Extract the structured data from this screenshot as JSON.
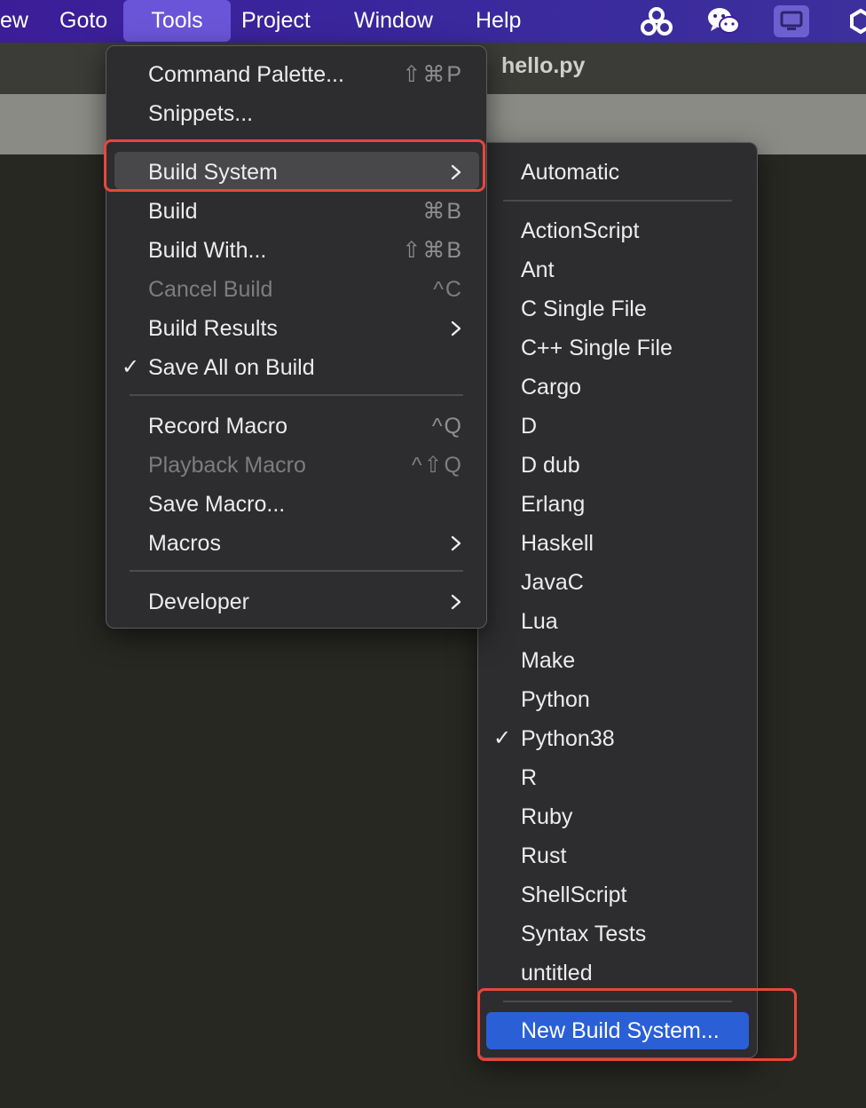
{
  "menubar": {
    "items": [
      {
        "label": "ew"
      },
      {
        "label": "Goto"
      },
      {
        "label": "Tools"
      },
      {
        "label": "Project"
      },
      {
        "label": "Window"
      },
      {
        "label": "Help"
      }
    ],
    "active": "Tools",
    "status_icons": [
      "baidu-netdisk-icon",
      "wechat-icon",
      "screen-share-icon",
      "app-icon"
    ]
  },
  "tab": {
    "title": "hello.py"
  },
  "tools_menu": {
    "items": [
      {
        "label": "Command Palette...",
        "shortcut": "⇧⌘P"
      },
      {
        "label": "Snippets..."
      },
      {
        "label": "Build System"
      },
      {
        "label": "Build",
        "shortcut": "⌘B"
      },
      {
        "label": "Build With...",
        "shortcut": "⇧⌘B"
      },
      {
        "label": "Cancel Build",
        "shortcut": "^C",
        "disabled": true
      },
      {
        "label": "Build Results"
      },
      {
        "label": "Save All on Build",
        "checked": true
      },
      {
        "label": "Record Macro",
        "shortcut": "^Q"
      },
      {
        "label": "Playback Macro",
        "shortcut": "^⇧Q",
        "disabled": true
      },
      {
        "label": "Save Macro..."
      },
      {
        "label": "Macros"
      },
      {
        "label": "Developer"
      }
    ],
    "check_glyph": "✓"
  },
  "build_system_menu": {
    "items": [
      {
        "label": "Automatic"
      },
      {
        "label": "ActionScript"
      },
      {
        "label": "Ant"
      },
      {
        "label": "C Single File"
      },
      {
        "label": "C++ Single File"
      },
      {
        "label": "Cargo"
      },
      {
        "label": "D"
      },
      {
        "label": "D dub"
      },
      {
        "label": "Erlang"
      },
      {
        "label": "Haskell"
      },
      {
        "label": "JavaC"
      },
      {
        "label": "Lua"
      },
      {
        "label": "Make"
      },
      {
        "label": "Python"
      },
      {
        "label": "Python38",
        "checked": true
      },
      {
        "label": "R"
      },
      {
        "label": "Ruby"
      },
      {
        "label": "Rust"
      },
      {
        "label": "ShellScript"
      },
      {
        "label": "Syntax Tests"
      },
      {
        "label": "untitled"
      },
      {
        "label": "New Build System..."
      }
    ],
    "check_glyph": "✓"
  },
  "colors": {
    "menubar": "#3b1d98",
    "active_menu": "#6a55d8",
    "menu_bg": "#2d2d2f",
    "highlight": "#2a5fd6",
    "annotation": "#e8463b",
    "editor_bg": "#272822"
  }
}
